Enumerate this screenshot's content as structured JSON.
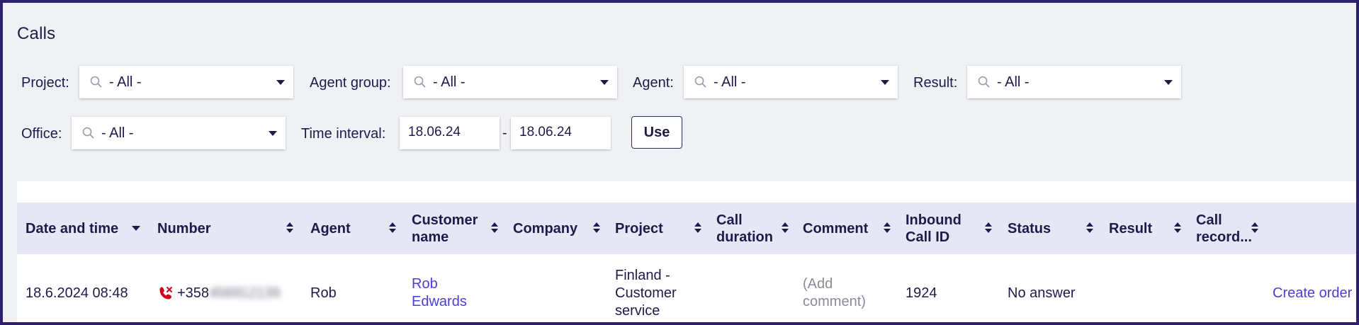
{
  "page": {
    "title": "Calls"
  },
  "filters": {
    "project": {
      "label": "Project:",
      "value": "- All -"
    },
    "agent_group": {
      "label": "Agent group:",
      "value": "- All -"
    },
    "agent": {
      "label": "Agent:",
      "value": "- All -"
    },
    "result": {
      "label": "Result:",
      "value": "- All -"
    },
    "office": {
      "label": "Office:",
      "value": "- All -"
    },
    "time_interval": {
      "label": "Time interval:",
      "from": "18.06.24",
      "separator": "-",
      "to": "18.06.24"
    },
    "use_label": "Use"
  },
  "table": {
    "columns": {
      "date_time": "Date and time",
      "number": "Number",
      "agent": "Agent",
      "customer_name_1": "Customer",
      "customer_name_2": "name",
      "company": "Company",
      "project": "Project",
      "call_duration_1": "Call",
      "call_duration_2": "duration",
      "comment": "Comment",
      "inbound_1": "Inbound",
      "inbound_2": "Call ID",
      "status": "Status",
      "result": "Result",
      "recording_1": "Call",
      "recording_2": "record..."
    },
    "rows": [
      {
        "date_time": "18.6.2024 08:48",
        "icon": "missed-call-icon",
        "number_prefix": "+358",
        "number_hidden": "456912139",
        "agent": "Rob",
        "customer_1": "Rob",
        "customer_2": "Edwards",
        "company": "",
        "project_1": "Finland -",
        "project_2": "Customer",
        "project_3": "service",
        "call_duration": "",
        "comment_1": "(Add",
        "comment_2": "comment)",
        "inbound_id": "1924",
        "status": "No answer",
        "result": "",
        "action": "Create order"
      }
    ]
  },
  "colors": {
    "border": "#2d1f6e",
    "background": "#f0f1f5",
    "text": "#1e1b4b",
    "link": "#4a3fd4",
    "header_bg": "#e6e6f5",
    "missed_call": "#d0021b"
  }
}
